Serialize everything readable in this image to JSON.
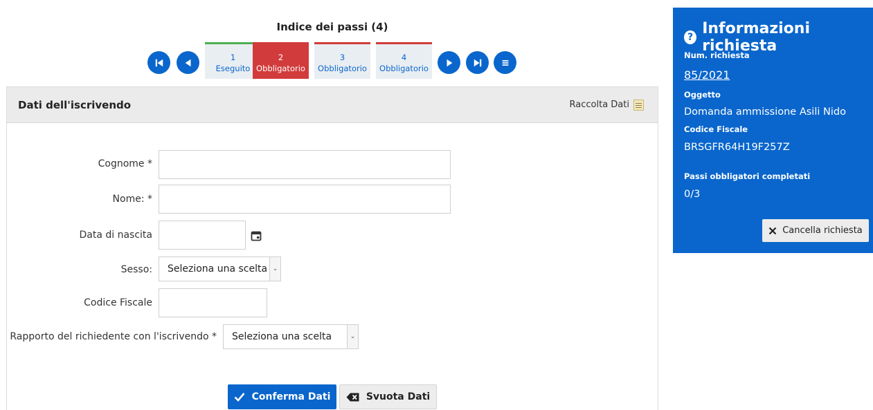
{
  "steps": {
    "title": "Indice dei passi (4)",
    "items": [
      {
        "num": "1",
        "label": "Eseguito"
      },
      {
        "num": "2",
        "label": "Obbligatorio"
      },
      {
        "num": "3",
        "label": "Obbligatorio"
      },
      {
        "num": "4",
        "label": "Obbligatorio"
      }
    ]
  },
  "panel": {
    "title": "Dati dell'iscrivendo",
    "tool_label": "Raccolta Dati"
  },
  "form": {
    "cognome_label": "Cognome *",
    "nome_label": "Nome: *",
    "nascita_label": "Data di nascita",
    "sesso_label": "Sesso:",
    "sesso_value": "Seleziona una scelta",
    "cf_label": "Codice Fiscale",
    "rapporto_label": "Rapporto del richiedente con l'iscrivendo *",
    "rapporto_value": "Seleziona una scelta",
    "confirm_label": "Conferma Dati",
    "clear_label": "Svuota Dati"
  },
  "info": {
    "title": "Informazioni richiesta",
    "num_label": "Num. richiesta",
    "num_value": "85/2021",
    "oggetto_label": "Oggetto",
    "oggetto_value": "Domanda ammissione Asili Nido",
    "cf_label": "Codice Fiscale",
    "cf_value": "BRSGFR64H19F257Z",
    "passi_label": "Passi obbligatori completati",
    "passi_value": "0/3",
    "cancel_label": "Cancella richiesta"
  },
  "colors": {
    "primary": "#0a66cc",
    "required": "#d23b3b",
    "done": "#4caf50"
  }
}
